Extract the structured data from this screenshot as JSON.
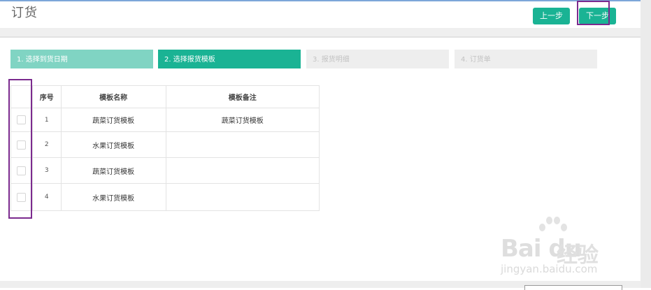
{
  "header": {
    "title": "订货",
    "prev_label": "上一步",
    "next_label": "下一步"
  },
  "steps": [
    {
      "label": "1. 选择到货日期",
      "state": "completed"
    },
    {
      "label": "2. 选择报货模板",
      "state": "active"
    },
    {
      "label": "3. 报货明细",
      "state": "pending"
    },
    {
      "label": "4. 订货单",
      "state": "pending"
    }
  ],
  "table": {
    "headers": [
      "",
      "序号",
      "模板名称",
      "模板备注"
    ],
    "rows": [
      {
        "index": "1",
        "name": "蔬菜订货模板",
        "note": "蔬菜订货模板"
      },
      {
        "index": "2",
        "name": "水果订货模板",
        "note": ""
      },
      {
        "index": "3",
        "name": "蔬菜订货模板",
        "note": ""
      },
      {
        "index": "4",
        "name": "水果订货模板",
        "note": ""
      }
    ]
  },
  "watermark": {
    "brand": "Bai du",
    "brand_suffix": "经验",
    "url": "jingyan.baidu.com"
  },
  "colors": {
    "accent": "#1ab394",
    "step_done": "#80d4c3",
    "step_pending": "#eeeeee",
    "annotation": "#7b2a8e"
  }
}
